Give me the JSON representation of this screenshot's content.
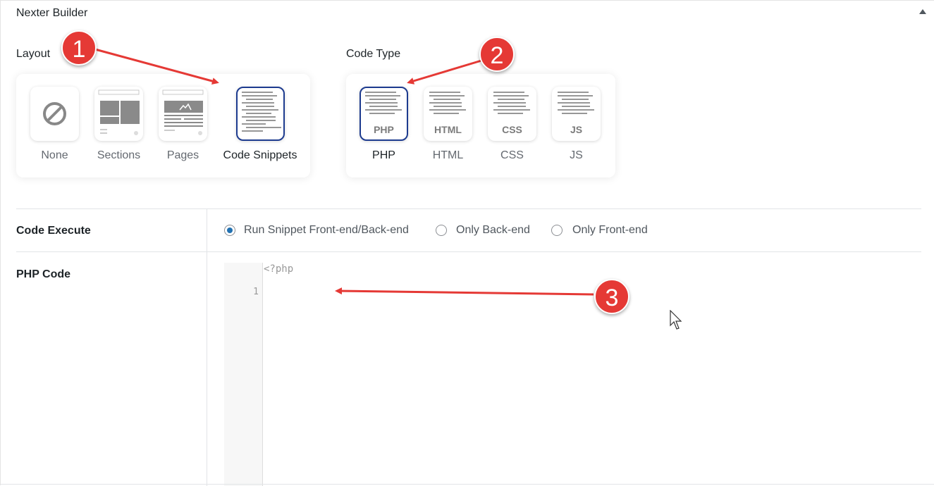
{
  "header": {
    "title": "Nexter Builder"
  },
  "layout": {
    "label": "Layout",
    "options": [
      {
        "label": "None",
        "selected": false
      },
      {
        "label": "Sections",
        "selected": false
      },
      {
        "label": "Pages",
        "selected": false
      },
      {
        "label": "Code Snippets",
        "selected": true
      }
    ]
  },
  "code_type": {
    "label": "Code Type",
    "options": [
      {
        "label": "PHP",
        "tag": "PHP",
        "selected": true
      },
      {
        "label": "HTML",
        "tag": "HTML",
        "selected": false
      },
      {
        "label": "CSS",
        "tag": "CSS",
        "selected": false
      },
      {
        "label": "JS",
        "tag": "JS",
        "selected": false
      }
    ]
  },
  "code_execute": {
    "label": "Code Execute",
    "options": [
      {
        "label": "Run Snippet Front-end/Back-end",
        "checked": true
      },
      {
        "label": "Only Back-end",
        "checked": false
      },
      {
        "label": "Only Front-end",
        "checked": false
      }
    ]
  },
  "php_code": {
    "label": "PHP Code",
    "prefix": "<?php",
    "line_number": "1"
  },
  "badges": [
    "1",
    "2",
    "3"
  ],
  "colors": {
    "accent": "#1d3b8f",
    "radio": "#2271b1",
    "badge": "#e53935"
  }
}
